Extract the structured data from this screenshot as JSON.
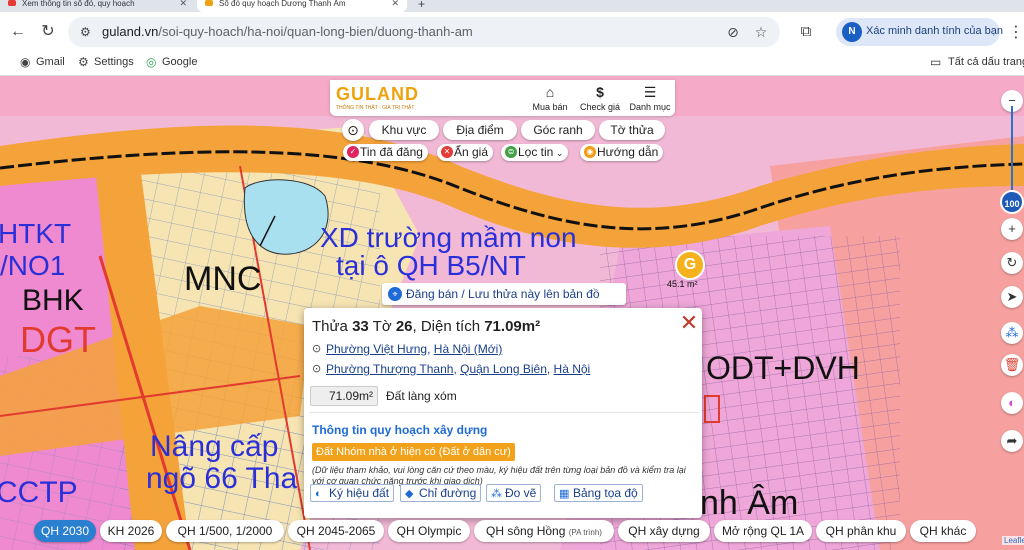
{
  "browser": {
    "tabs": [
      {
        "title": "Xem thông tin sổ đỏ, quy hoạch"
      },
      {
        "title": "Sổ đỏ quy hoạch Dương Thanh Âm"
      }
    ],
    "url_host": "guland.vn",
    "url_path": "/soi-quy-hoach/ha-noi/quan-long-bien/duong-thanh-am",
    "verify_label": "Xác minh danh tính của bạn",
    "verify_badge": "N",
    "bookmarks": [
      {
        "label": "Gmail",
        "icon": "gmail-icon"
      },
      {
        "label": "Settings",
        "icon": "gear-icon"
      },
      {
        "label": "Google",
        "icon": "google-icon"
      }
    ],
    "all_bookmarks": "Tất cả dấu trang"
  },
  "guland": {
    "logo": "GULAND",
    "tagline": "THÔNG TIN THẬT - GIÁ TRỊ THẬT",
    "actions": [
      {
        "label": "Mua bán",
        "icon": "house-icon"
      },
      {
        "label": "Check giá",
        "icon": "dollar-icon"
      },
      {
        "label": "Danh mục",
        "icon": "menu-icon"
      }
    ],
    "tabs": [
      "Khu vực",
      "Địa điểm",
      "Góc ranh",
      "Tờ thửa"
    ],
    "filters": [
      {
        "label": "Tin đã đăng",
        "color": "#e0245e"
      },
      {
        "label": "Ẩn giá",
        "color": "#e53935"
      },
      {
        "label": "Lọc tin",
        "color": "#43a047"
      },
      {
        "label": "Hướng dẫn",
        "color": "#f39c12"
      }
    ],
    "post_banner": "Đăng bán / Lưu thửa này lên bản đồ",
    "pin_label": "45.1 m²",
    "zoom": "100"
  },
  "map": {
    "labels": [
      "HTKT",
      "/NO1",
      "BHK",
      "DGT",
      "MNC",
      "XD trường mầm non",
      "tại ô QH B5/NT",
      "ODT+DVH",
      "Nâng cấp",
      "ngõ 66 Tha",
      "CCTP",
      "nh Âm"
    ]
  },
  "popup": {
    "title_prefix": "Thửa",
    "parcel_no": "33",
    "sheet_prefix": "Tờ",
    "sheet_no": "26",
    "area_prefix": ", Diện tích",
    "area": "71.09m²",
    "address_new": {
      "ward": "Phường Việt Hưng",
      "city": "Hà Nội (Mới)"
    },
    "address_old": {
      "ward": "Phường Thượng Thanh",
      "district": "Quận Long Biên",
      "city": "Hà Nội"
    },
    "area_value": "71.09m²",
    "land_type": "Đất làng xóm",
    "section_title": "Thông tin quy hoạch xây dựng",
    "land_badge": "Đất Nhóm nhà ở hiện có (Đất ở dân cư)",
    "note": "(Dữ liệu tham khảo, vui lòng căn cứ theo màu, ký hiệu đất trên từng loại bản đồ và kiểm tra lại với cơ quan chức năng trước khi giao dịch)",
    "buttons": [
      {
        "label": "Ký hiệu đất",
        "icon": "palette-icon"
      },
      {
        "label": "Chỉ đường",
        "icon": "directions-icon"
      },
      {
        "label": "Đo vẽ",
        "icon": "measure-icon"
      },
      {
        "label": "Bảng tọa độ",
        "icon": "table-icon"
      }
    ]
  },
  "layers": [
    {
      "label": "QH 2030"
    },
    {
      "label": "KH 2026"
    },
    {
      "label": "QH 1/500, 1/2000"
    },
    {
      "label": "QH 2045-2065"
    },
    {
      "label": "QH Olympic"
    },
    {
      "label": "QH sông Hồng",
      "sub": "(PA trình)"
    },
    {
      "label": "QH xây dựng"
    },
    {
      "label": "Mở rộng QL 1A"
    },
    {
      "label": "QH phân khu"
    },
    {
      "label": "QH khác"
    }
  ],
  "attribution": "Leaflet"
}
